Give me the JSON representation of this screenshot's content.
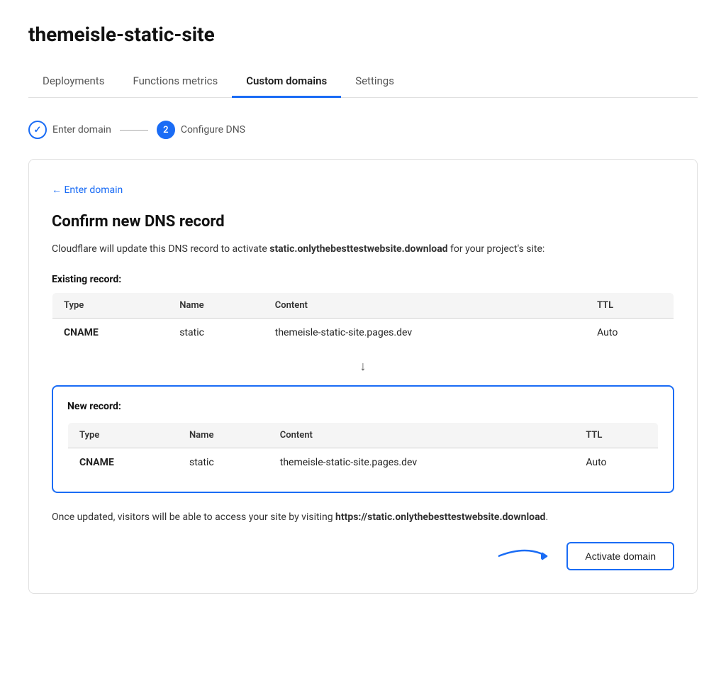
{
  "app": {
    "title": "themeisle-static-site"
  },
  "tabs": [
    {
      "id": "deployments",
      "label": "Deployments",
      "active": false
    },
    {
      "id": "functions-metrics",
      "label": "Functions metrics",
      "active": false
    },
    {
      "id": "custom-domains",
      "label": "Custom domains",
      "active": true
    },
    {
      "id": "settings",
      "label": "Settings",
      "active": false
    }
  ],
  "stepper": {
    "step1": {
      "label": "Enter domain",
      "state": "done",
      "icon": "✓"
    },
    "step2": {
      "label": "Configure DNS",
      "state": "active",
      "number": "2"
    }
  },
  "card": {
    "back_link": "← Enter domain",
    "title": "Confirm new DNS record",
    "description_before": "Cloudflare will update this DNS record to activate ",
    "description_domain": "static.onlythebesttestwebsite.download",
    "description_after": " for your project's site:",
    "existing_record_label": "Existing record:",
    "table_headers": [
      "Type",
      "Name",
      "Content",
      "TTL"
    ],
    "existing_rows": [
      {
        "type": "CNAME",
        "name": "static",
        "content": "themeisle-static-site.pages.dev",
        "ttl": "Auto"
      }
    ],
    "new_record_label": "New record:",
    "new_rows": [
      {
        "type": "CNAME",
        "name": "static",
        "content": "themeisle-static-site.pages.dev",
        "ttl": "Auto"
      }
    ],
    "footer_before": "Once updated, visitors will be able to access your site by visiting ",
    "footer_url": "https://static.onlythebesttestwebsite.download",
    "footer_after": ".",
    "activate_label": "Activate domain"
  }
}
